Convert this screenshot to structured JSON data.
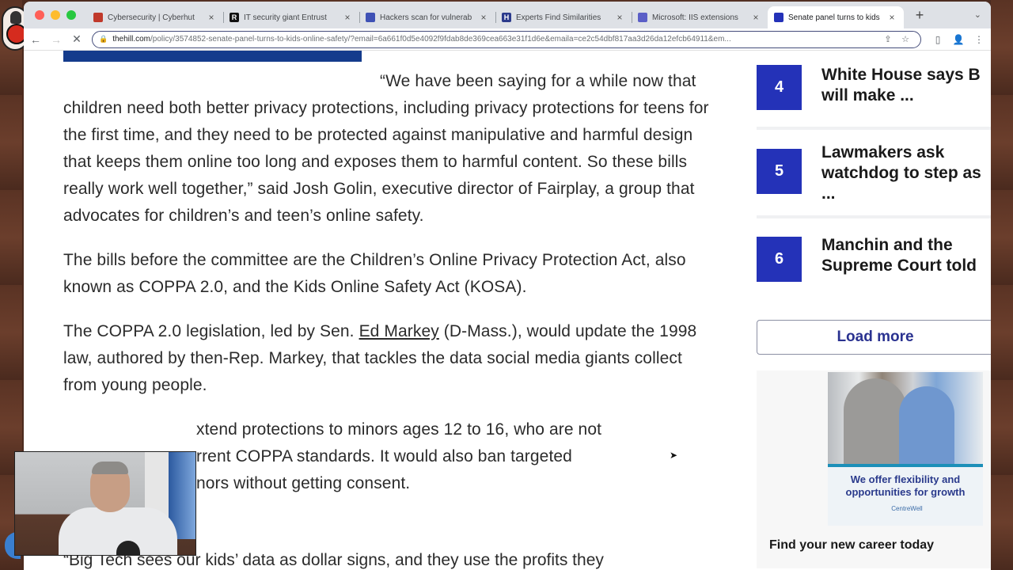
{
  "browser": {
    "tabs": [
      {
        "title": "Cybersecurity | Cyberhut",
        "favicon": "red-shield",
        "favicon_color": "#c0392b",
        "active": false
      },
      {
        "title": "IT security giant Entrust",
        "favicon": "R",
        "favicon_color": "#111111",
        "active": false
      },
      {
        "title": "Hackers scan for vulnerab",
        "favicon": "doc",
        "favicon_color": "#3f51b5",
        "active": false
      },
      {
        "title": "Experts Find Similarities",
        "favicon": "H",
        "favicon_color": "#2b3a8c",
        "active": false
      },
      {
        "title": "Microsoft: IIS extensions",
        "favicon": "doc",
        "favicon_color": "#5b5fc7",
        "active": false
      },
      {
        "title": "Senate panel turns to kids",
        "favicon": "hill",
        "favicon_color": "#2432b8",
        "active": true
      }
    ],
    "tab_close": "×",
    "new_tab": "+",
    "tab_menu": "⌄",
    "url_host": "thehill.com",
    "url_path": "/policy/3574852-senate-panel-turns-to-kids-online-safety/?email=6a661f0d5e4092f9fdab8de369cea663e31f1d6e&emaila=ce2c54dbf817aa3d26da12efcb64911&em...",
    "nav": {
      "back": "←",
      "forward": "→",
      "stop": "✕"
    },
    "icons": {
      "lock": "🔒",
      "share": "⇪",
      "star": "☆",
      "sidepanel": "▯",
      "profile": "👤",
      "menu": "⋮"
    }
  },
  "article": {
    "paragraphs": [
      "“We have been saying for a while now that children need both better privacy protections, including privacy protections for teens for the first time, and they need to be protected against manipulative and harmful design that keeps them online too long and exposes them to harmful content. So these bills really work well together,” said Josh Golin, executive director of Fairplay, a group that advocates for children’s and teen’s online safety.",
      "The bills before the committee are the Children’s Online Privacy Protection Act, also known as COPPA 2.0, and the Kids Online Safety Act (KOSA)."
    ],
    "p3_before": "The COPPA 2.0 legislation, led by Sen. ",
    "p3_link": "Ed Markey",
    "p3_after": " (D-Mass.), would update the 1998 law, authored by then-Rep. Markey, that tackles the data social media giants collect from young people.",
    "partial_lines": [
      "xtend protections to minors ages 12 to 16, who are not",
      "rrent COPPA standards. It would also ban targeted",
      "nors without getting consent."
    ],
    "bottom_line": "“Big Tech sees our kids’ data as dollar signs, and they use the profits they"
  },
  "sidebar": {
    "trending": [
      {
        "rank": "4",
        "title_lines": [
          "White House says B",
          "will make ..."
        ]
      },
      {
        "rank": "5",
        "title_lines": [
          "Lawmakers ask",
          "watchdog to step as",
          "..."
        ]
      },
      {
        "rank": "6",
        "title_lines": [
          "Manchin and the",
          "Supreme Court told"
        ]
      }
    ],
    "load_more": "Load more",
    "ad": {
      "headline": "We offer flexibility and opportunities for growth",
      "logo_text": "CentreWell",
      "caption": "Find your new career today"
    }
  },
  "colors": {
    "accent": "#2432b8",
    "hero_bar": "#143b8c",
    "load_more_text": "#2a3290"
  }
}
